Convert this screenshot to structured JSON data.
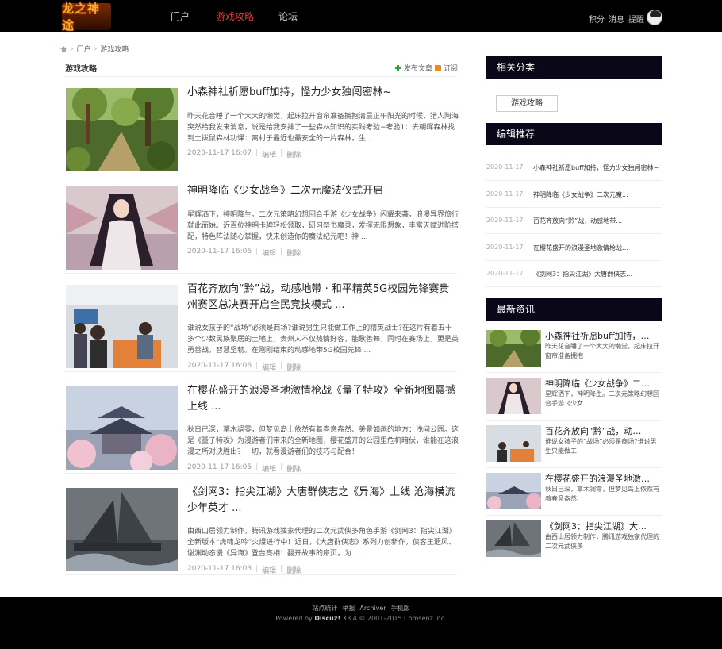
{
  "header": {
    "logo_text": "龙之神途",
    "nav": [
      "门户",
      "游戏攻略",
      "论坛"
    ],
    "active_nav": 1,
    "links": [
      "积分",
      "消息",
      "提醒"
    ]
  },
  "breadcrumb": [
    "门户",
    "游戏攻略"
  ],
  "main": {
    "title": "游戏攻略",
    "publish_label": "发布文章",
    "subscribe_label": "订阅",
    "edit_label": "编辑",
    "delete_label": "删除",
    "articles": [
      {
        "title": "小森神社祈愿buff加持，怪力少女独闯密林~",
        "summary": "昨天花音睡了一个大大的懒觉，起床拉开窗帘准备拥抱清晨正午阳光的时候，猎人阿海突然给我发来消息，说是给我安排了一些森林知识的实践考验~考验1：去朝晖森林找到土拨鼠森林功课：离村子最近也最安全的一片森林，生 ...",
        "date": "2020-11-17 16:07",
        "image": "forest"
      },
      {
        "title": "神明降临《少女战争》二次元魔法仪式开启",
        "summary": "星辉洒下，神明降生。二次元策略幻想回合手游《少女战争》闪耀来袭，浪漫异界旅行就此而始。近百位神明卡牌轻松领取，研习禁书魔录，发挥无限想象，丰富天赋进阶搭配，特色阵法随心掌握，快来创造你的魔法纪元吧！神 ...",
        "date": "2020-11-17 16:06",
        "image": "goddess"
      },
      {
        "title": "百花齐放向“黔”战，动感地带 · 和平精英5G校园先锋赛贵州赛区总决赛开启全民竞技模式 ...",
        "summary": "谁说女孩子的“战场”必须是商场?谁说男生只能做工作上的精英战士?在这片有着五十多个少数民族聚居的土地上，贵州人不仅热情好客，能歌善舞，同时在赛场上，更是英勇善战，智慧坚韧。在刚刚结束的动感地带5G校园先锋 ...",
        "date": "2020-11-17 16:06",
        "image": "event"
      },
      {
        "title": "在樱花盛开的浪漫圣地激情枪战《量子特攻》全新地图震撼上线 ...",
        "summary": "秋日已深，草木凋零，但梦见岛上依然有着春意盎然、美景如画的地方：浅间公园。这是《量子特攻》为漫游者们带来的全新地图，樱花盛开的公园里危机暗伏，谁能在这浪漫之所对决胜出？一切，就看漫游者们的技巧与配合！",
        "date": "2020-11-17 16:05",
        "image": "sakura"
      },
      {
        "title": "《剑网3：指尖江湖》大唐群侠志之《异海》上线 沧海横流少年英才 ...",
        "summary": "由西山居领力制作，腾讯游戏独家代理的二次元武侠多角色手游《剑网3：指尖江湖》全新版本“虎啸龙吟”火爆进行中！近日，《大唐群侠志》系列力创新作，侠客王遗风、谢渊动态漫《异海》登台亮相！翻开故事的扉页，为 ...",
        "date": "2020-11-17 16:03",
        "image": "ship"
      }
    ]
  },
  "sidebar": {
    "category_title": "相关分类",
    "category_button": "游戏攻略",
    "recommend_title": "编辑推荐",
    "recommend": [
      {
        "date": "2020-11-17",
        "title": "小森神社祈愿buff加持，怪力少女独闯密林~"
      },
      {
        "date": "2020-11-17",
        "title": "神明降临《少女战争》二次元魔..."
      },
      {
        "date": "2020-11-17",
        "title": "百花齐放向“黔”战，动感地带…"
      },
      {
        "date": "2020-11-17",
        "title": "在樱花盛开的浪漫圣地激情枪战…"
      },
      {
        "date": "2020-11-17",
        "title": "《剑网3：指尖江湖》大唐群侠志…"
      }
    ],
    "news_title": "最新资讯",
    "news": [
      {
        "title": "小森神社祈愿buff加持，…",
        "summary": "昨天花音睡了一个大大的懒觉，起床拉开窗帘准备拥抱",
        "image": "forest"
      },
      {
        "title": "神明降临《少女战争》二…",
        "summary": "星辉洒下，神明降生。二次元策略幻想回合手游《少女",
        "image": "goddess"
      },
      {
        "title": "百花齐放向“黔”战，动…",
        "summary": "谁说女孩子的“战场”必须是商场?谁说男生只能做工",
        "image": "event"
      },
      {
        "title": "在樱花盛开的浪漫圣地激…",
        "summary": "秋日已深，草木凋零，但梦见岛上依然有着春意盎然、",
        "image": "sakura"
      },
      {
        "title": "《剑网3：指尖江湖》大…",
        "summary": "由西山居领力制作，腾讯游戏独家代理的二次元武侠多",
        "image": "ship"
      }
    ]
  },
  "footer": {
    "links": [
      "站点统计",
      "举报",
      "Archiver",
      "手机版"
    ],
    "powered_prefix": "Powered by",
    "powered_brand": "Discuz!",
    "powered_suffix": "X3.4 © 2001-2015 Comsenz Inc."
  }
}
